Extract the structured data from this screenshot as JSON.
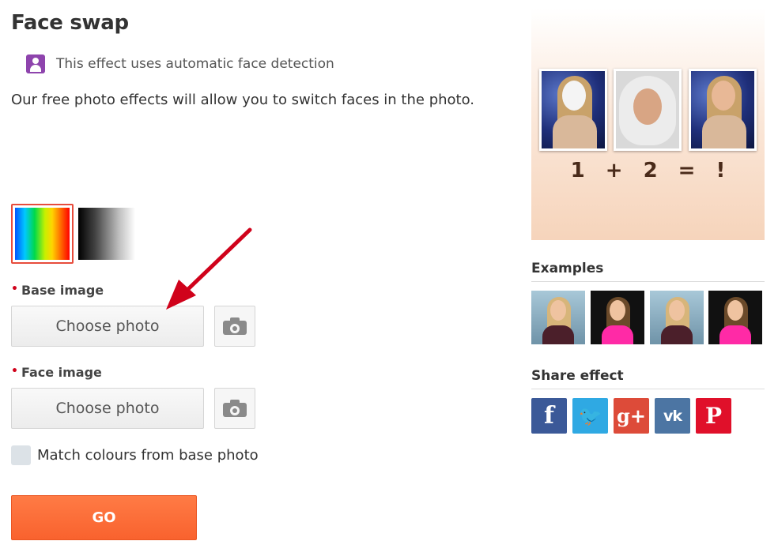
{
  "header": {
    "title": "Face swap",
    "detection_note": "This effect uses automatic face detection",
    "intro": "Our free photo effects will allow you to switch faces in the photo."
  },
  "color_options": [
    {
      "icon": "rainbow-gradient-swatch",
      "selected": true
    },
    {
      "icon": "black-white-gradient-swatch",
      "selected": false
    }
  ],
  "form": {
    "base_image": {
      "required_mark": "•",
      "label": "Base image",
      "button": "Choose photo",
      "camera_icon": "camera-icon"
    },
    "face_image": {
      "required_mark": "•",
      "label": "Face image",
      "button": "Choose photo",
      "camera_icon": "camera-icon"
    },
    "match_colours": {
      "label": "Match colours from base photo",
      "checked": false
    },
    "go_button": "GO"
  },
  "preview": {
    "equation": [
      "1",
      "+",
      "2",
      "=",
      "!"
    ]
  },
  "sidebar": {
    "examples_heading": "Examples",
    "share_heading": "Share effect",
    "share_buttons": [
      {
        "glyph": "f",
        "icon": "facebook-icon",
        "color": "#3b5998"
      },
      {
        "glyph": "🐦",
        "icon": "twitter-icon",
        "color": "#2fa9e3"
      },
      {
        "glyph": "g+",
        "icon": "google-plus-icon",
        "color": "#dd4b39"
      },
      {
        "glyph": "vk",
        "icon": "vk-icon",
        "color": "#4c75a3"
      },
      {
        "glyph": "P",
        "icon": "pinterest-icon",
        "color": "#e0102a"
      }
    ]
  },
  "colors": {
    "accent_go": "#f9622e",
    "required_mark": "#d0021b",
    "selected_border": "#e74c3c",
    "annotation_arrow": "#d0021b"
  }
}
